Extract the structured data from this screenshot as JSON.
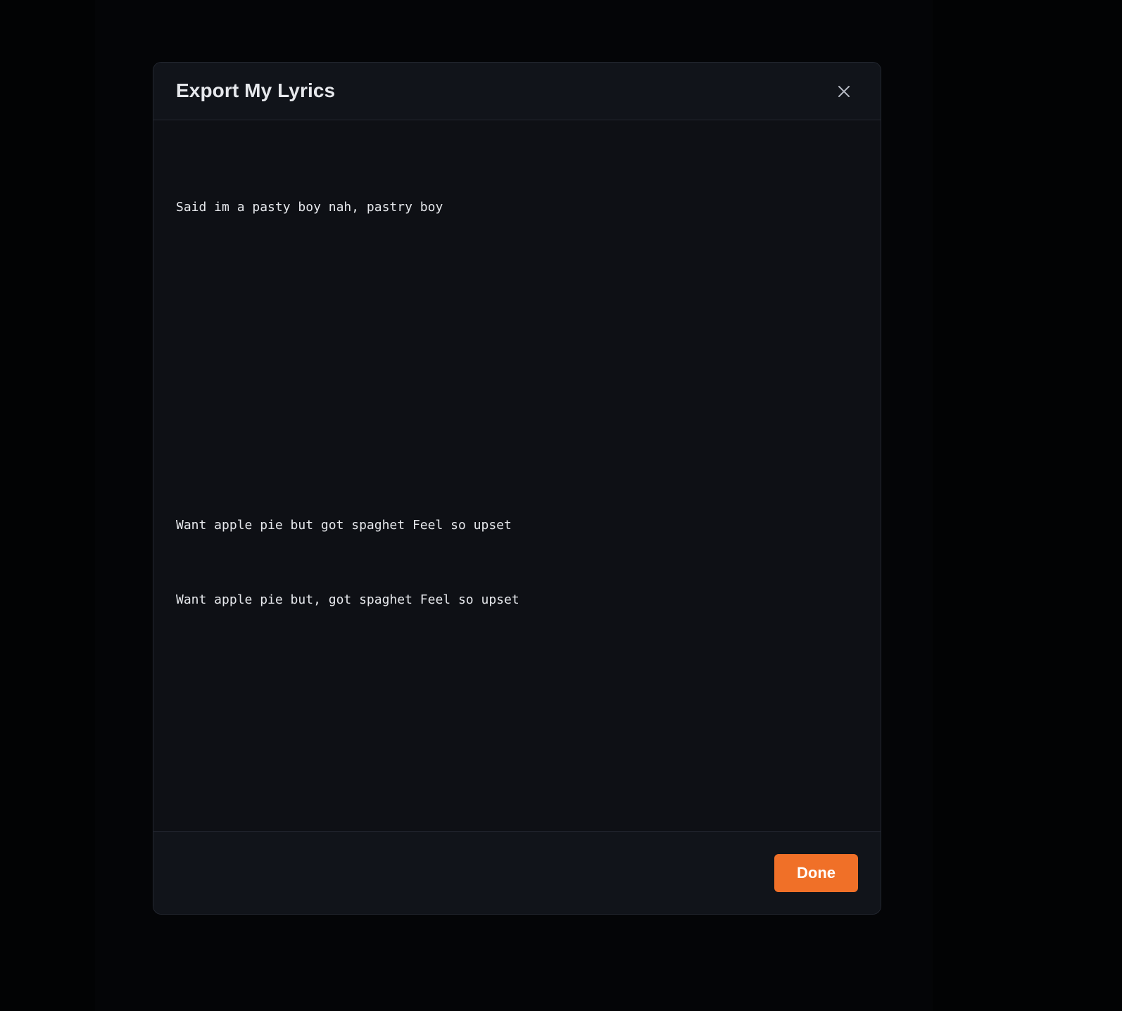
{
  "dialog": {
    "title": "Export My Lyrics",
    "close_icon": "close-icon",
    "lyrics": [
      "Said im a pasty boy nah, pastry boy",
      "Want apple pie but got spaghet Feel so upset",
      "Want apple pie but, got spaghet Feel so upset"
    ],
    "done_label": "Done"
  },
  "colors": {
    "accent": "#f07028",
    "background": "#020304",
    "dialog_background": "#0e1015",
    "text": "#e6e8ec"
  }
}
